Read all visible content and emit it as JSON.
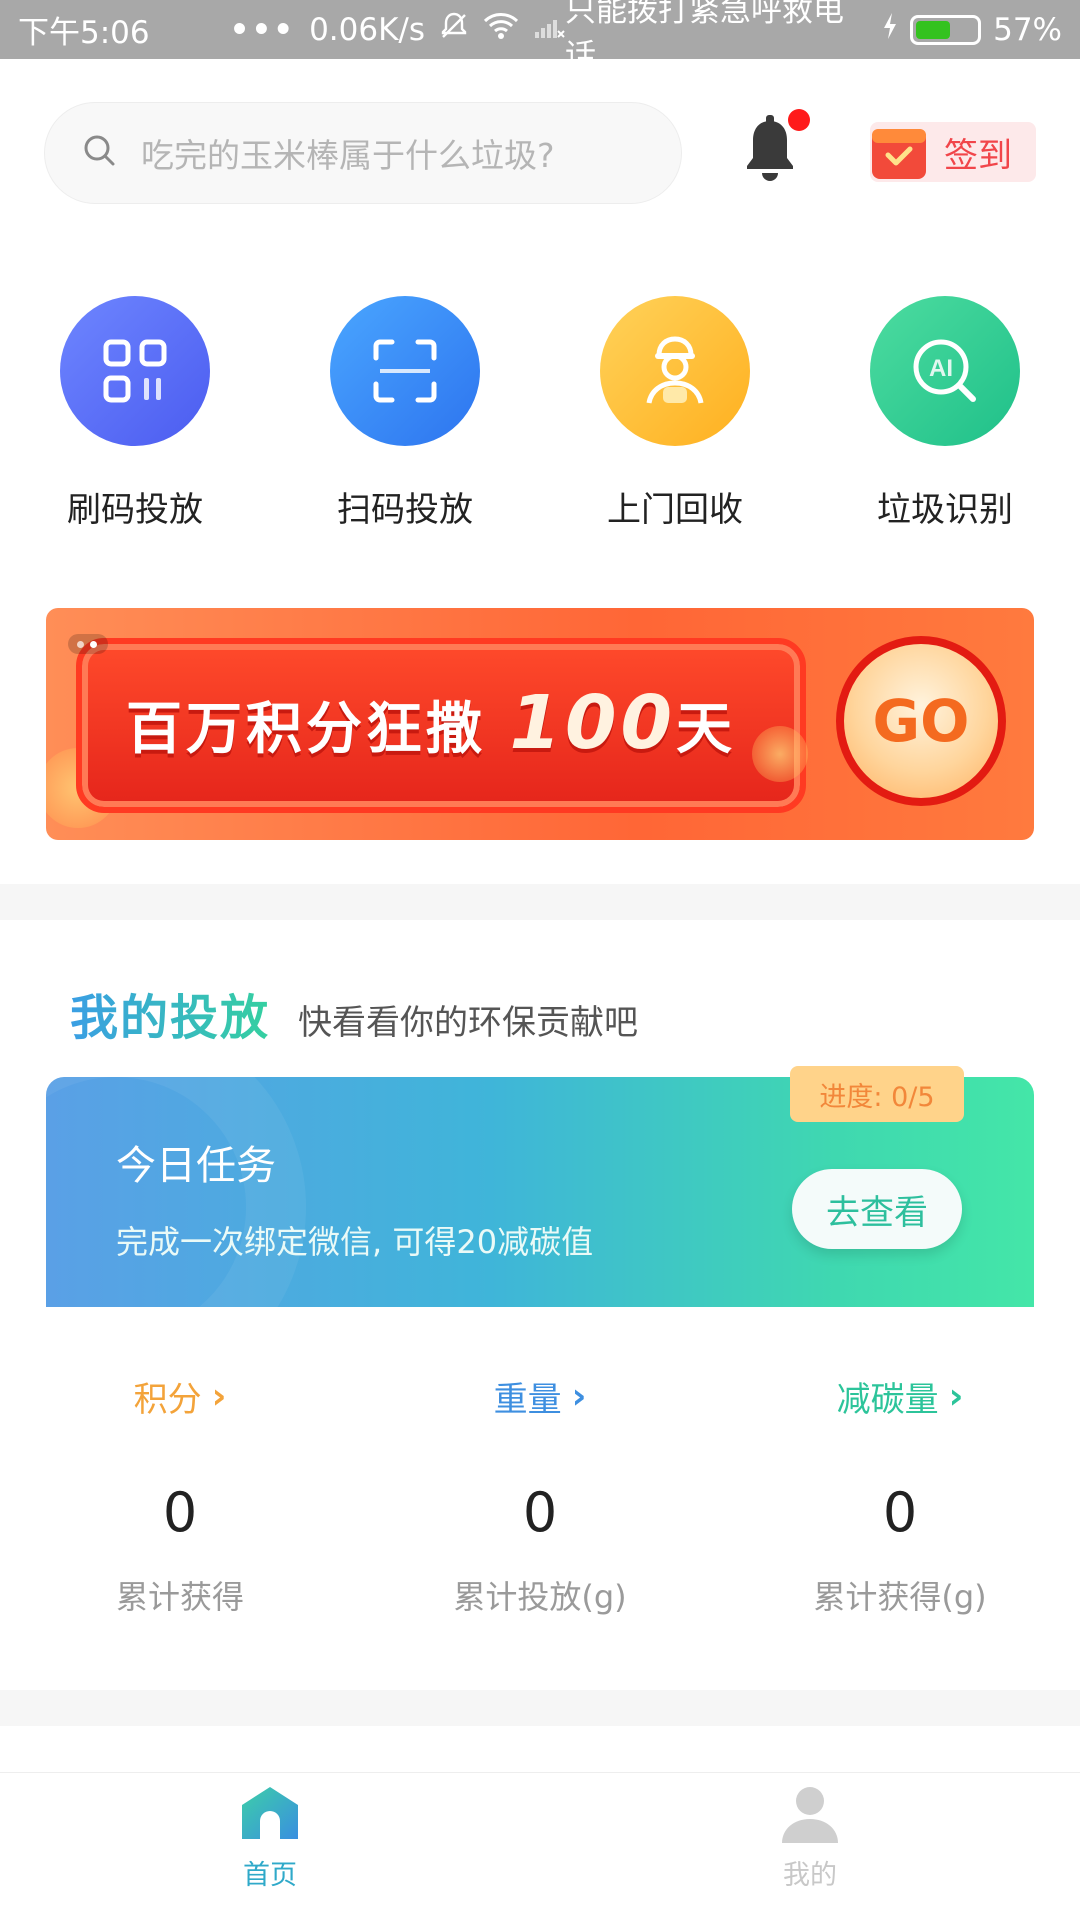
{
  "status_bar": {
    "time": "下午5:06",
    "dots": "•••",
    "net_speed": "0.06K/s",
    "carrier_note": "只能拨打紧急呼救电话",
    "battery_percent": "57%",
    "battery_level": 0.57
  },
  "header": {
    "search_placeholder": "吃完的玉米棒属于什么垃圾?",
    "signin_label": "签到",
    "notification_dot": true
  },
  "quick_actions": [
    {
      "label": "刷码投放",
      "icon": "qr-code-icon",
      "color": "#5570f5"
    },
    {
      "label": "扫码投放",
      "icon": "scan-icon",
      "color": "#3b8ff3"
    },
    {
      "label": "上门回收",
      "icon": "courier-icon",
      "color": "#ffc43a"
    },
    {
      "label": "垃圾识别",
      "icon": "ai-search-icon",
      "color": "#2fcf8f"
    }
  ],
  "banner": {
    "text_prefix": "百万积分狂撒",
    "text_number": "100",
    "text_suffix": "天",
    "go_label": "GO"
  },
  "my_deposits": {
    "title": "我的投放",
    "subtitle": "快看看你的环保贡献吧",
    "task": {
      "title": "今日任务",
      "description": "完成一次绑定微信, 可得20减碳值",
      "button_label": "去查看",
      "progress_label": "进度: 0/5",
      "progress_done": 0,
      "progress_total": 5
    },
    "stats": [
      {
        "label": "积分",
        "value": "0",
        "caption": "累计获得",
        "color": "#f3a33a"
      },
      {
        "label": "重量",
        "value": "0",
        "caption": "累计投放(g)",
        "color": "#3e8fe0"
      },
      {
        "label": "减碳量",
        "value": "0",
        "caption": "累计获得(g)",
        "color": "#2cc49a"
      }
    ]
  },
  "bottom_nav": [
    {
      "label": "首页",
      "icon": "home-icon",
      "active": true,
      "color": "#2fa9c9"
    },
    {
      "label": "我的",
      "icon": "profile-icon",
      "active": false,
      "color": "#c8c8c8"
    }
  ]
}
